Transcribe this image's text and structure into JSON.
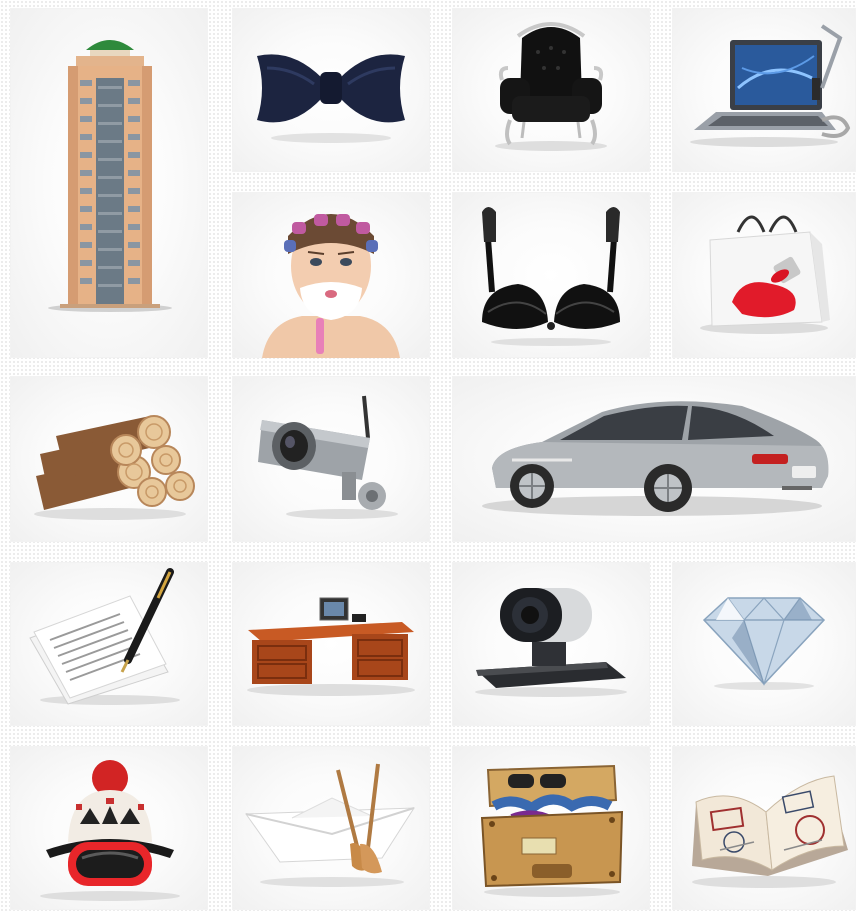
{
  "tiles": [
    {
      "id": "building",
      "icon": "skyscraper-icon"
    },
    {
      "id": "bow-tie",
      "icon": "bow-tie-icon"
    },
    {
      "id": "armchair",
      "icon": "armchair-icon"
    },
    {
      "id": "laptop",
      "icon": "laptop-tools-icon"
    },
    {
      "id": "woman-shaving",
      "icon": "woman-shaving-icon"
    },
    {
      "id": "lingerie",
      "icon": "bra-icon"
    },
    {
      "id": "shopping-bag",
      "icon": "shopping-bag-paint-icon"
    },
    {
      "id": "firewood",
      "icon": "firewood-icon"
    },
    {
      "id": "security-camera",
      "icon": "security-camera-icon"
    },
    {
      "id": "car",
      "icon": "car-icon"
    },
    {
      "id": "contract",
      "icon": "contract-pen-icon"
    },
    {
      "id": "office-desk",
      "icon": "office-desk-icon"
    },
    {
      "id": "video-conference-camera",
      "icon": "video-conference-camera-icon"
    },
    {
      "id": "diamond",
      "icon": "diamond-icon"
    },
    {
      "id": "ski-gear",
      "icon": "ski-hat-goggles-icon"
    },
    {
      "id": "paper-boat",
      "icon": "paper-boat-paddles-icon"
    },
    {
      "id": "suitcase",
      "icon": "suitcase-icon"
    },
    {
      "id": "passport",
      "icon": "passport-icon"
    }
  ],
  "colors": {
    "background": "#ffffff",
    "tile": "#f4f4f4",
    "dot": "#e6e6e6"
  }
}
